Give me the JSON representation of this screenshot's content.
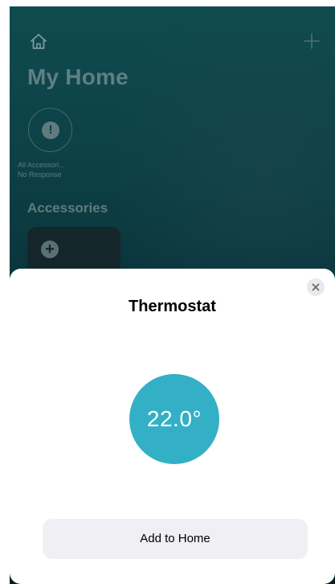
{
  "header": {
    "home_icon": "house-icon",
    "add_icon": "plus-icon",
    "title": "My Home"
  },
  "status": {
    "icon": "exclamation-icon",
    "line1": "All Accessori...",
    "line2": "No Response"
  },
  "accessories": {
    "heading": "Accessories",
    "add_tile_icon": "plus-circle-icon"
  },
  "sheet": {
    "title": "Thermostat",
    "temperature": "22.0°",
    "close_icon": "close-icon",
    "add_button_label": "Add to Home"
  },
  "colors": {
    "background_top": "#0f4b4f",
    "background_bottom": "#071e25",
    "dial": "#33b0c6",
    "button_bg": "#f0f0f4"
  }
}
